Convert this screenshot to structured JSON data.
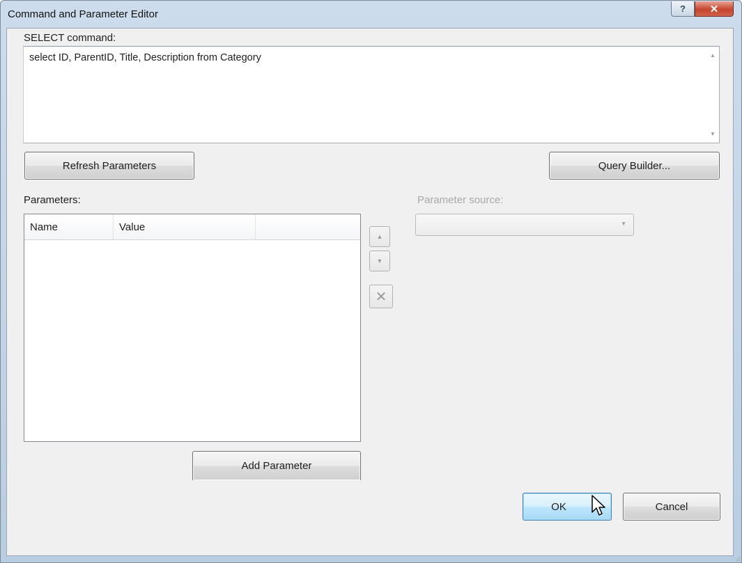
{
  "window": {
    "title": "Command and Parameter Editor",
    "help_glyph": "?",
    "close_glyph": "✕"
  },
  "command": {
    "label": "SELECT command:",
    "text": "select ID, ParentID, Title, Description from Category"
  },
  "buttons": {
    "refresh": "Refresh Parameters",
    "query_builder": "Query Builder...",
    "add_parameter": "Add Parameter",
    "ok": "OK",
    "cancel": "Cancel"
  },
  "parameters": {
    "label": "Parameters:",
    "columns": [
      "Name",
      "Value",
      ""
    ],
    "rows": []
  },
  "parameter_source": {
    "label": "Parameter source:",
    "value": ""
  },
  "side_buttons": {
    "move_up_glyph": "▲",
    "move_down_glyph": "▼",
    "delete_glyph": "✕"
  },
  "scroll_arrows": {
    "up": "▲",
    "down": "▼"
  },
  "combo_arrow": "▼",
  "colors": {
    "titlebar": "#cddcec",
    "client_bg": "#f0f0f0",
    "ok_accent": "#bee6fd",
    "close_red": "#c6452d"
  }
}
